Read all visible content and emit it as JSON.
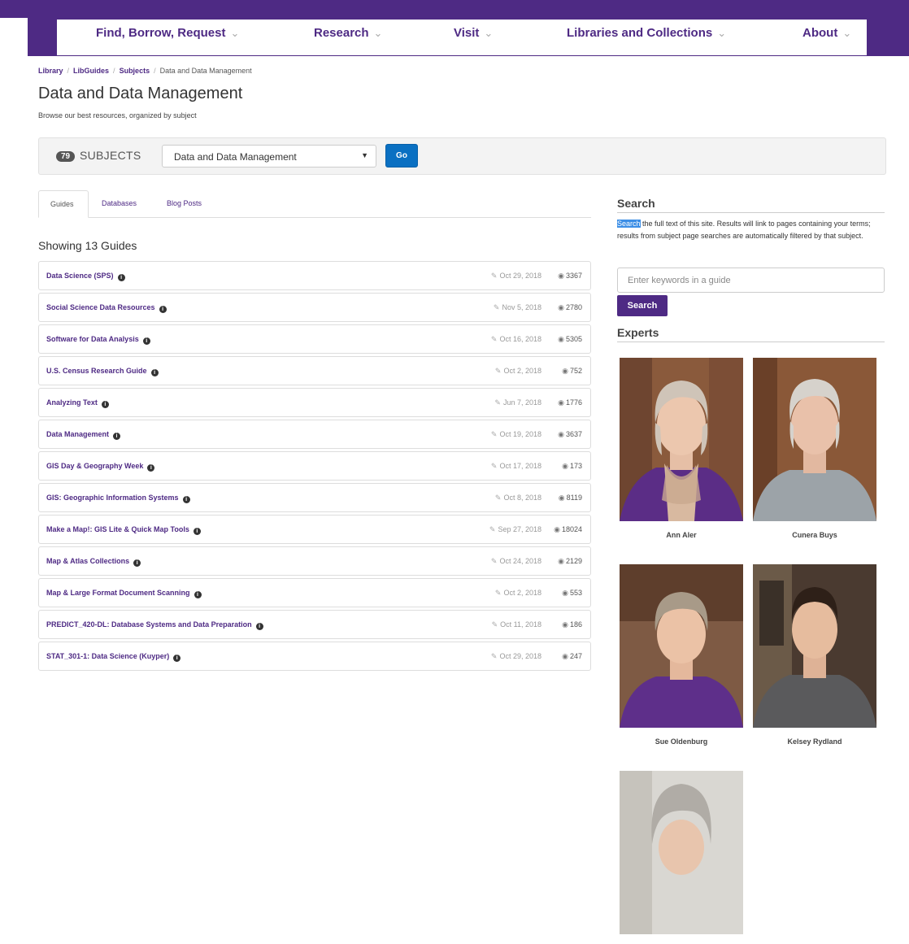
{
  "nav": [
    {
      "label": "Find, Borrow, Request"
    },
    {
      "label": "Research"
    },
    {
      "label": "Visit"
    },
    {
      "label": "Libraries and Collections"
    },
    {
      "label": "About"
    }
  ],
  "breadcrumb": [
    {
      "label": "Library"
    },
    {
      "label": "LibGuides"
    },
    {
      "label": "Subjects"
    },
    {
      "label": "Data and Data Management"
    }
  ],
  "page": {
    "title": "Data and Data Management",
    "subtitle": "Browse our best resources, organized by subject"
  },
  "subject_bar": {
    "count": "79",
    "label": "SUBJECTS",
    "selected": "Data and Data Management",
    "go_label": "Go"
  },
  "tabs": [
    {
      "label": "Guides",
      "active": true
    },
    {
      "label": "Databases",
      "active": false
    },
    {
      "label": "Blog Posts",
      "active": false
    }
  ],
  "guides_heading": "Showing 13 Guides",
  "guides": [
    {
      "title": "Data Science (SPS)",
      "date": "Oct 29, 2018",
      "views": "3367"
    },
    {
      "title": "Social Science Data Resources",
      "date": "Nov 5, 2018",
      "views": "2780"
    },
    {
      "title": "Software for Data Analysis",
      "date": "Oct 16, 2018",
      "views": "5305"
    },
    {
      "title": "U.S. Census Research Guide",
      "date": "Oct 2, 2018",
      "views": "752"
    },
    {
      "title": "Analyzing Text",
      "date": "Jun 7, 2018",
      "views": "1776"
    },
    {
      "title": "Data Management",
      "date": "Oct 19, 2018",
      "views": "3637"
    },
    {
      "title": "GIS Day & Geography Week",
      "date": "Oct 17, 2018",
      "views": "173"
    },
    {
      "title": "GIS: Geographic Information Systems",
      "date": "Oct 8, 2018",
      "views": "8119"
    },
    {
      "title": "Make a Map!: GIS Lite & Quick Map Tools",
      "date": "Sep 27, 2018",
      "views": "18024"
    },
    {
      "title": "Map & Atlas Collections",
      "date": "Oct 24, 2018",
      "views": "2129"
    },
    {
      "title": "Map & Large Format Document Scanning",
      "date": "Oct 2, 2018",
      "views": "553"
    },
    {
      "title": "PREDICT_420-DL: Database Systems and Data Preparation",
      "date": "Oct 11, 2018",
      "views": "186"
    },
    {
      "title": "STAT_301-1: Data Science (Kuyper)",
      "date": "Oct 29, 2018",
      "views": "247"
    }
  ],
  "search": {
    "heading": "Search",
    "help_highlight": "Search",
    "help_rest": " the full text of this site. Results will link to pages containing your terms; results from subject page searches are automatically filtered by that subject.",
    "placeholder": "Enter keywords in a guide",
    "button_label": "Search"
  },
  "experts": {
    "heading": "Experts",
    "people": [
      {
        "name": "Ann Aler"
      },
      {
        "name": "Cunera Buys"
      },
      {
        "name": "Sue Oldenburg"
      },
      {
        "name": "Kelsey Rydland"
      },
      {
        "name": ""
      }
    ]
  },
  "colors": {
    "brand_purple": "#4e2a84",
    "go_blue": "#0a70c2",
    "highlight_blue": "#3c8ee6"
  },
  "icons": {
    "edit": "edit-icon",
    "views": "eye-icon",
    "info": "info-icon",
    "chevron": "chevron-down-icon"
  }
}
